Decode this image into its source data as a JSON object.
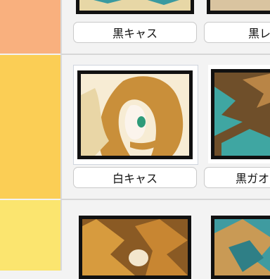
{
  "tiers": [
    {
      "color": "#f9b07e"
    },
    {
      "color": "#fbce55"
    },
    {
      "color": "#fbe56f"
    }
  ],
  "cards": [
    {
      "label": "黒キャス"
    },
    {
      "label": "黒レ"
    },
    {
      "label": "白キャス"
    },
    {
      "label": "黒ガオ"
    }
  ]
}
